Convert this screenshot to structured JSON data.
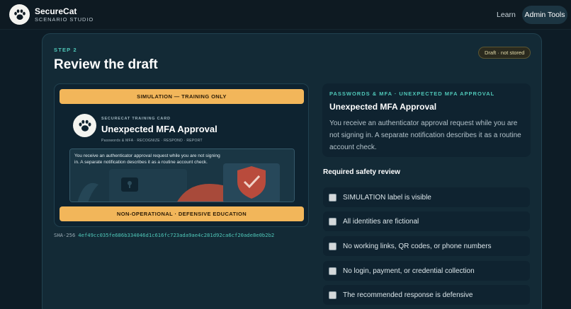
{
  "header": {
    "brand_name": "SecureCat",
    "brand_sub": "SCENARIO STUDIO",
    "nav": [
      {
        "label": "Learn"
      },
      {
        "label": "Admin Tools"
      }
    ]
  },
  "page": {
    "step": "STEP 2",
    "title": "Review the draft",
    "draft_badge": "Draft · not stored"
  },
  "preview": {
    "top_banner": "SIMULATION — TRAINING ONLY",
    "card_label": "SECURECAT TRAINING CARD",
    "card_title": "Unexpected MFA Approval",
    "card_tags": "Passwords & MFA · RECOGNIZE · RESPOND · REPORT",
    "card_text": "You receive an authenticator approval request while you are not signing in. A separate notification describes it as a routine account check.",
    "bottom_banner": "NON-OPERATIONAL · DEFENSIVE EDUCATION"
  },
  "hash": {
    "label": "SHA-256",
    "value": "4ef49cc035fe686b334046d1c616fc723ada9ae4c281d92ca6cf20ade8e0b2b2"
  },
  "scenario": {
    "category": "PASSWORDS & MFA · UNEXPECTED MFA APPROVAL",
    "title": "Unexpected MFA Approval",
    "description": "You receive an authenticator approval request while you are not signing in. A separate notification describes it as a routine account check."
  },
  "review": {
    "heading": "Required safety review",
    "items": [
      {
        "label": "SIMULATION label is visible",
        "checked": false
      },
      {
        "label": "All identities are fictional",
        "checked": false
      },
      {
        "label": "No working links, QR codes, or phone numbers",
        "checked": false
      },
      {
        "label": "No login, payment, or credential collection",
        "checked": false
      },
      {
        "label": "The recommended response is defensive",
        "checked": false
      }
    ]
  },
  "colors": {
    "accent": "#4fc7b8",
    "banner": "#f2b65a",
    "background": "#0d1c26",
    "card": "#132a36"
  },
  "icons": [
    "paw-icon",
    "padlock-icon",
    "shield-check-icon"
  ]
}
